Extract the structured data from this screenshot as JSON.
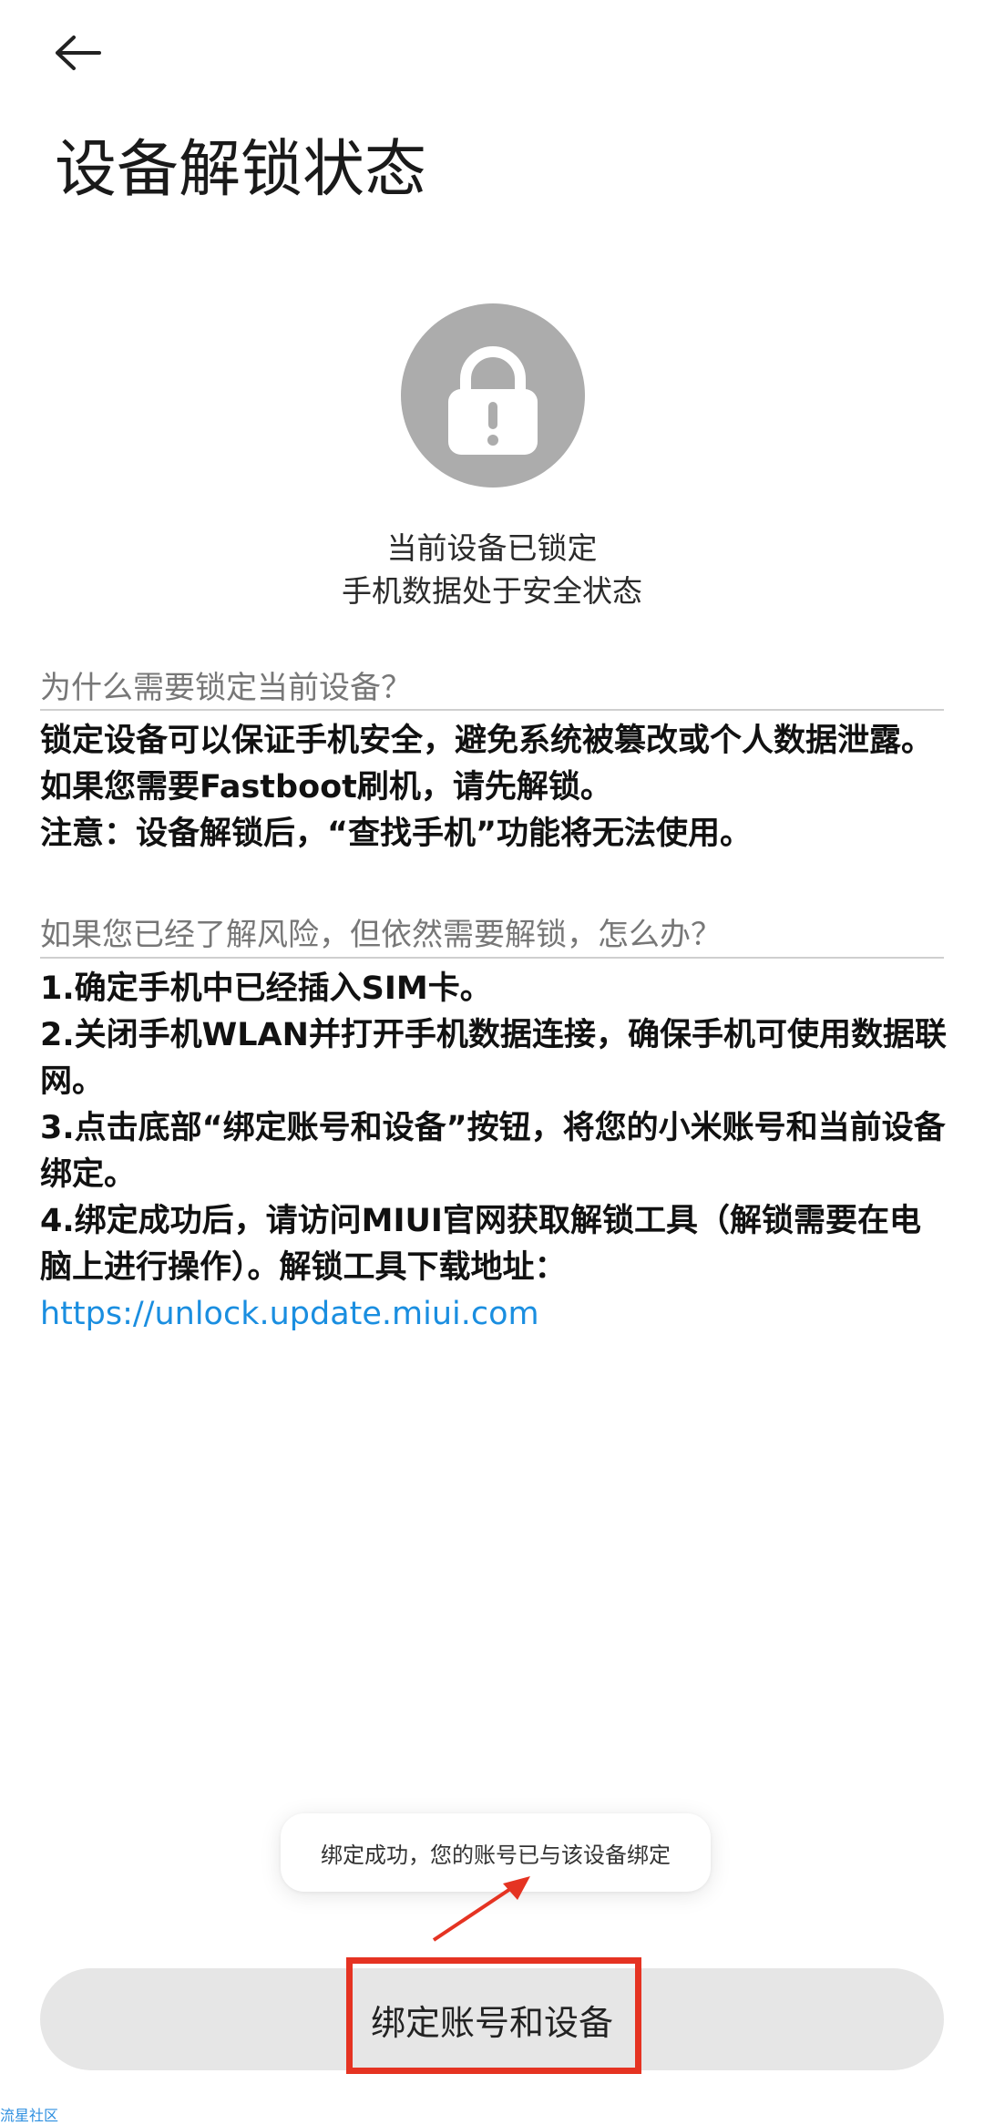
{
  "header": {
    "back_icon": "back-arrow-icon",
    "title": "设备解锁状态"
  },
  "status": {
    "icon": "lock-icon",
    "line1": "当前设备已锁定",
    "line2": "手机数据处于安全状态"
  },
  "section1": {
    "heading": "为什么需要锁定当前设备？",
    "lines": [
      "锁定设备可以保证手机安全，避免系统被篡改或个人数据泄露。如果您需要Fastboot刷机，请先解锁。",
      "注意：设备解锁后，“查找手机”功能将无法使用。"
    ]
  },
  "section2": {
    "heading": "如果您已经了解风险，但依然需要解锁，怎么办？",
    "steps": [
      "1.确定手机中已经插入SIM卡。",
      "2.关闭手机WLAN并打开手机数据连接，确保手机可使用数据联网。",
      "3.点击底部“绑定账号和设备”按钮，将您的小米账号和当前设备绑定。",
      "4.绑定成功后，请访问MIUI官网获取解锁工具（解锁需要在电脑上进行操作）。解锁工具下载地址："
    ],
    "link": "https://unlock.update.miui.com"
  },
  "toast": "绑定成功，您的账号已与该设备绑定",
  "bind_button_label": "绑定账号和设备",
  "watermark": "流星社区",
  "colors": {
    "link": "#1a8ee0",
    "annotation": "#e53322",
    "lock_circle": "#acacac",
    "button_bg": "#e6e6e6"
  }
}
